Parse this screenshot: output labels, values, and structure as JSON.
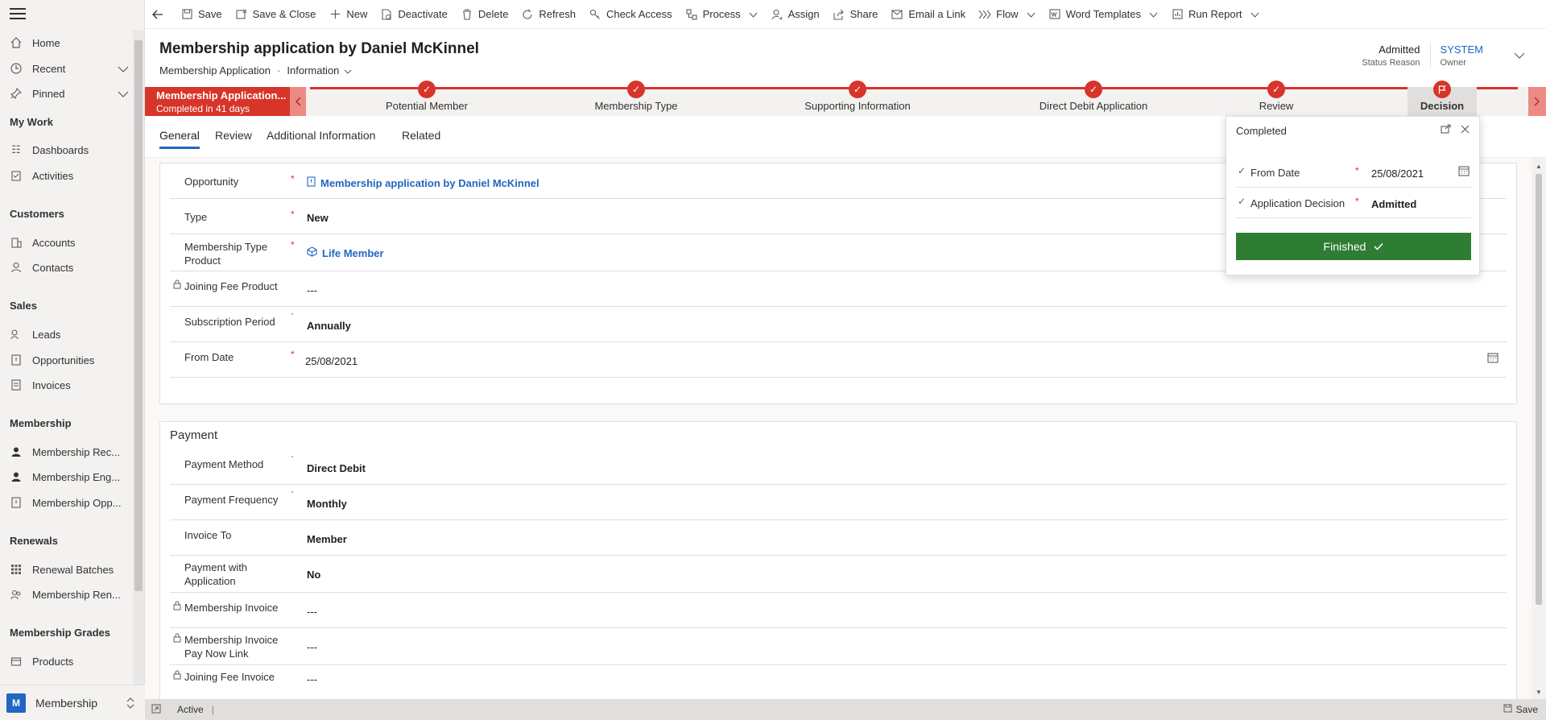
{
  "sidebar": {
    "items": [
      {
        "label": "Home",
        "icon": "home-icon"
      },
      {
        "label": "Recent",
        "icon": "clock-icon"
      },
      {
        "label": "Pinned",
        "icon": "pin-icon"
      }
    ],
    "groups": [
      {
        "title": "My Work",
        "items": [
          {
            "label": "Dashboards"
          },
          {
            "label": "Activities"
          }
        ]
      },
      {
        "title": "Customers",
        "items": [
          {
            "label": "Accounts"
          },
          {
            "label": "Contacts"
          }
        ]
      },
      {
        "title": "Sales",
        "items": [
          {
            "label": "Leads"
          },
          {
            "label": "Opportunities"
          },
          {
            "label": "Invoices"
          }
        ]
      },
      {
        "title": "Membership",
        "items": [
          {
            "label": "Membership Rec..."
          },
          {
            "label": "Membership Eng..."
          },
          {
            "label": "Membership Opp..."
          }
        ]
      },
      {
        "title": "Renewals",
        "items": [
          {
            "label": "Renewal Batches"
          },
          {
            "label": "Membership Ren..."
          }
        ]
      },
      {
        "title": "Membership Grades",
        "items": [
          {
            "label": "Products"
          }
        ]
      }
    ],
    "area": {
      "badge": "M",
      "label": "Membership"
    }
  },
  "toolbar": {
    "save": "Save",
    "save_close": "Save & Close",
    "new": "New",
    "deactivate": "Deactivate",
    "delete": "Delete",
    "refresh": "Refresh",
    "check_access": "Check Access",
    "process": "Process",
    "assign": "Assign",
    "share": "Share",
    "email_link": "Email a Link",
    "flow": "Flow",
    "word_templates": "Word Templates",
    "run_report": "Run Report"
  },
  "header": {
    "title": "Membership application by Daniel McKinnel",
    "entity": "Membership Application",
    "form": "Information",
    "status_reason_value": "Admitted",
    "status_reason_label": "Status Reason",
    "owner_value": "SYSTEM",
    "owner_label": "Owner"
  },
  "bpf": {
    "active_title": "Membership Application...",
    "active_sub": "Completed in 41 days",
    "stages": [
      "Potential Member",
      "Membership Type",
      "Supporting Information",
      "Direct Debit Application",
      "Review",
      "Decision"
    ]
  },
  "tabs": [
    "General",
    "Review",
    "Additional Information",
    "Related"
  ],
  "general": {
    "opportunity_label": "Opportunity",
    "opportunity_value": "Membership application by Daniel McKinnel",
    "type_label": "Type",
    "type_value": "New",
    "mtp_label": "Membership Type Product",
    "mtp_value": "Life Member",
    "jfp_label": "Joining Fee Product",
    "jfp_value": "---",
    "subperiod_label": "Subscription Period",
    "subperiod_value": "Annually",
    "fromdate_label": "From Date",
    "fromdate_value": "25/08/2021"
  },
  "payment": {
    "title": "Payment",
    "method_label": "Payment Method",
    "method_value": "Direct Debit",
    "freq_label": "Payment Frequency",
    "freq_value": "Monthly",
    "invoiceto_label": "Invoice To",
    "invoiceto_value": "Member",
    "pwa_label": "Payment with Application",
    "pwa_value": "No",
    "mi_label": "Membership Invoice",
    "mi_value": "---",
    "mipnl_label": "Membership Invoice Pay Now Link",
    "mipnl_value": "---",
    "jfi_label": "Joining Fee Invoice",
    "jfi_value": "---"
  },
  "flyout": {
    "title": "Completed",
    "from_date_label": "From Date",
    "from_date_value": "25/08/2021",
    "decision_label": "Application Decision",
    "decision_value": "Admitted",
    "finish_label": "Finished"
  },
  "status": {
    "state": "Active",
    "save": "Save"
  },
  "colors": {
    "accent": "#2266c2",
    "bpf_red": "#d7342a",
    "finish_green": "#2e7d32"
  }
}
